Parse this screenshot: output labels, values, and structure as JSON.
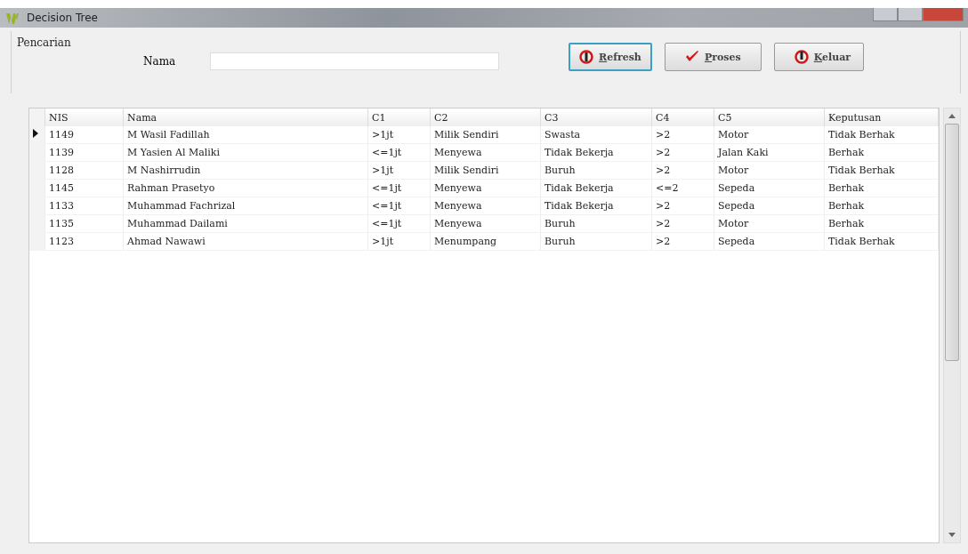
{
  "window": {
    "title": "Decision Tree"
  },
  "search": {
    "group_label": "Pencarian",
    "field_label": "Nama"
  },
  "buttons": [
    {
      "label": "Refresh",
      "kind": "refresh",
      "focused": true,
      "mnemonic": true
    },
    {
      "label": "Proses",
      "kind": "check",
      "focused": false,
      "mnemonic": true
    },
    {
      "label": "Keluar",
      "kind": "exit",
      "focused": false,
      "mnemonic": true
    }
  ],
  "table": {
    "columns": [
      "NIS",
      "Nama",
      "C1",
      "C2",
      "C3",
      "C4",
      "C5",
      "Keputusan"
    ],
    "rows": [
      {
        "selected": true,
        "cells": [
          "1149",
          "M Wasil Fadillah",
          ">1jt",
          "Milik Sendiri",
          "Swasta",
          ">2",
          "Motor",
          "Tidak Berhak"
        ]
      },
      {
        "selected": false,
        "cells": [
          "1139",
          "M Yasien Al Maliki",
          "<=1jt",
          "Menyewa",
          "Tidak Bekerja",
          ">2",
          "Jalan Kaki",
          "Berhak"
        ]
      },
      {
        "selected": false,
        "cells": [
          "1128",
          "M Nashirrudin",
          ">1jt",
          "Milik Sendiri",
          "Buruh",
          ">2",
          "Motor",
          "Tidak Berhak"
        ]
      },
      {
        "selected": false,
        "cells": [
          "1145",
          "Rahman Prasetyo",
          "<=1jt",
          "Menyewa",
          "Tidak Bekerja",
          "<=2",
          "Sepeda",
          "Berhak"
        ]
      },
      {
        "selected": false,
        "cells": [
          "1133",
          "Muhammad Fachrizal",
          "<=1jt",
          "Menyewa",
          "Tidak Bekerja",
          ">2",
          "Sepeda",
          "Berhak"
        ]
      },
      {
        "selected": false,
        "cells": [
          "1135",
          "Muhammad Dailami",
          "<=1jt",
          "Menyewa",
          "Buruh",
          ">2",
          "Motor",
          "Berhak"
        ]
      },
      {
        "selected": false,
        "cells": [
          "1123",
          "Ahmad Nawawi",
          ">1jt",
          "Menumpang",
          "Buruh",
          ">2",
          "Sepeda",
          "Tidak Berhak"
        ]
      }
    ]
  }
}
